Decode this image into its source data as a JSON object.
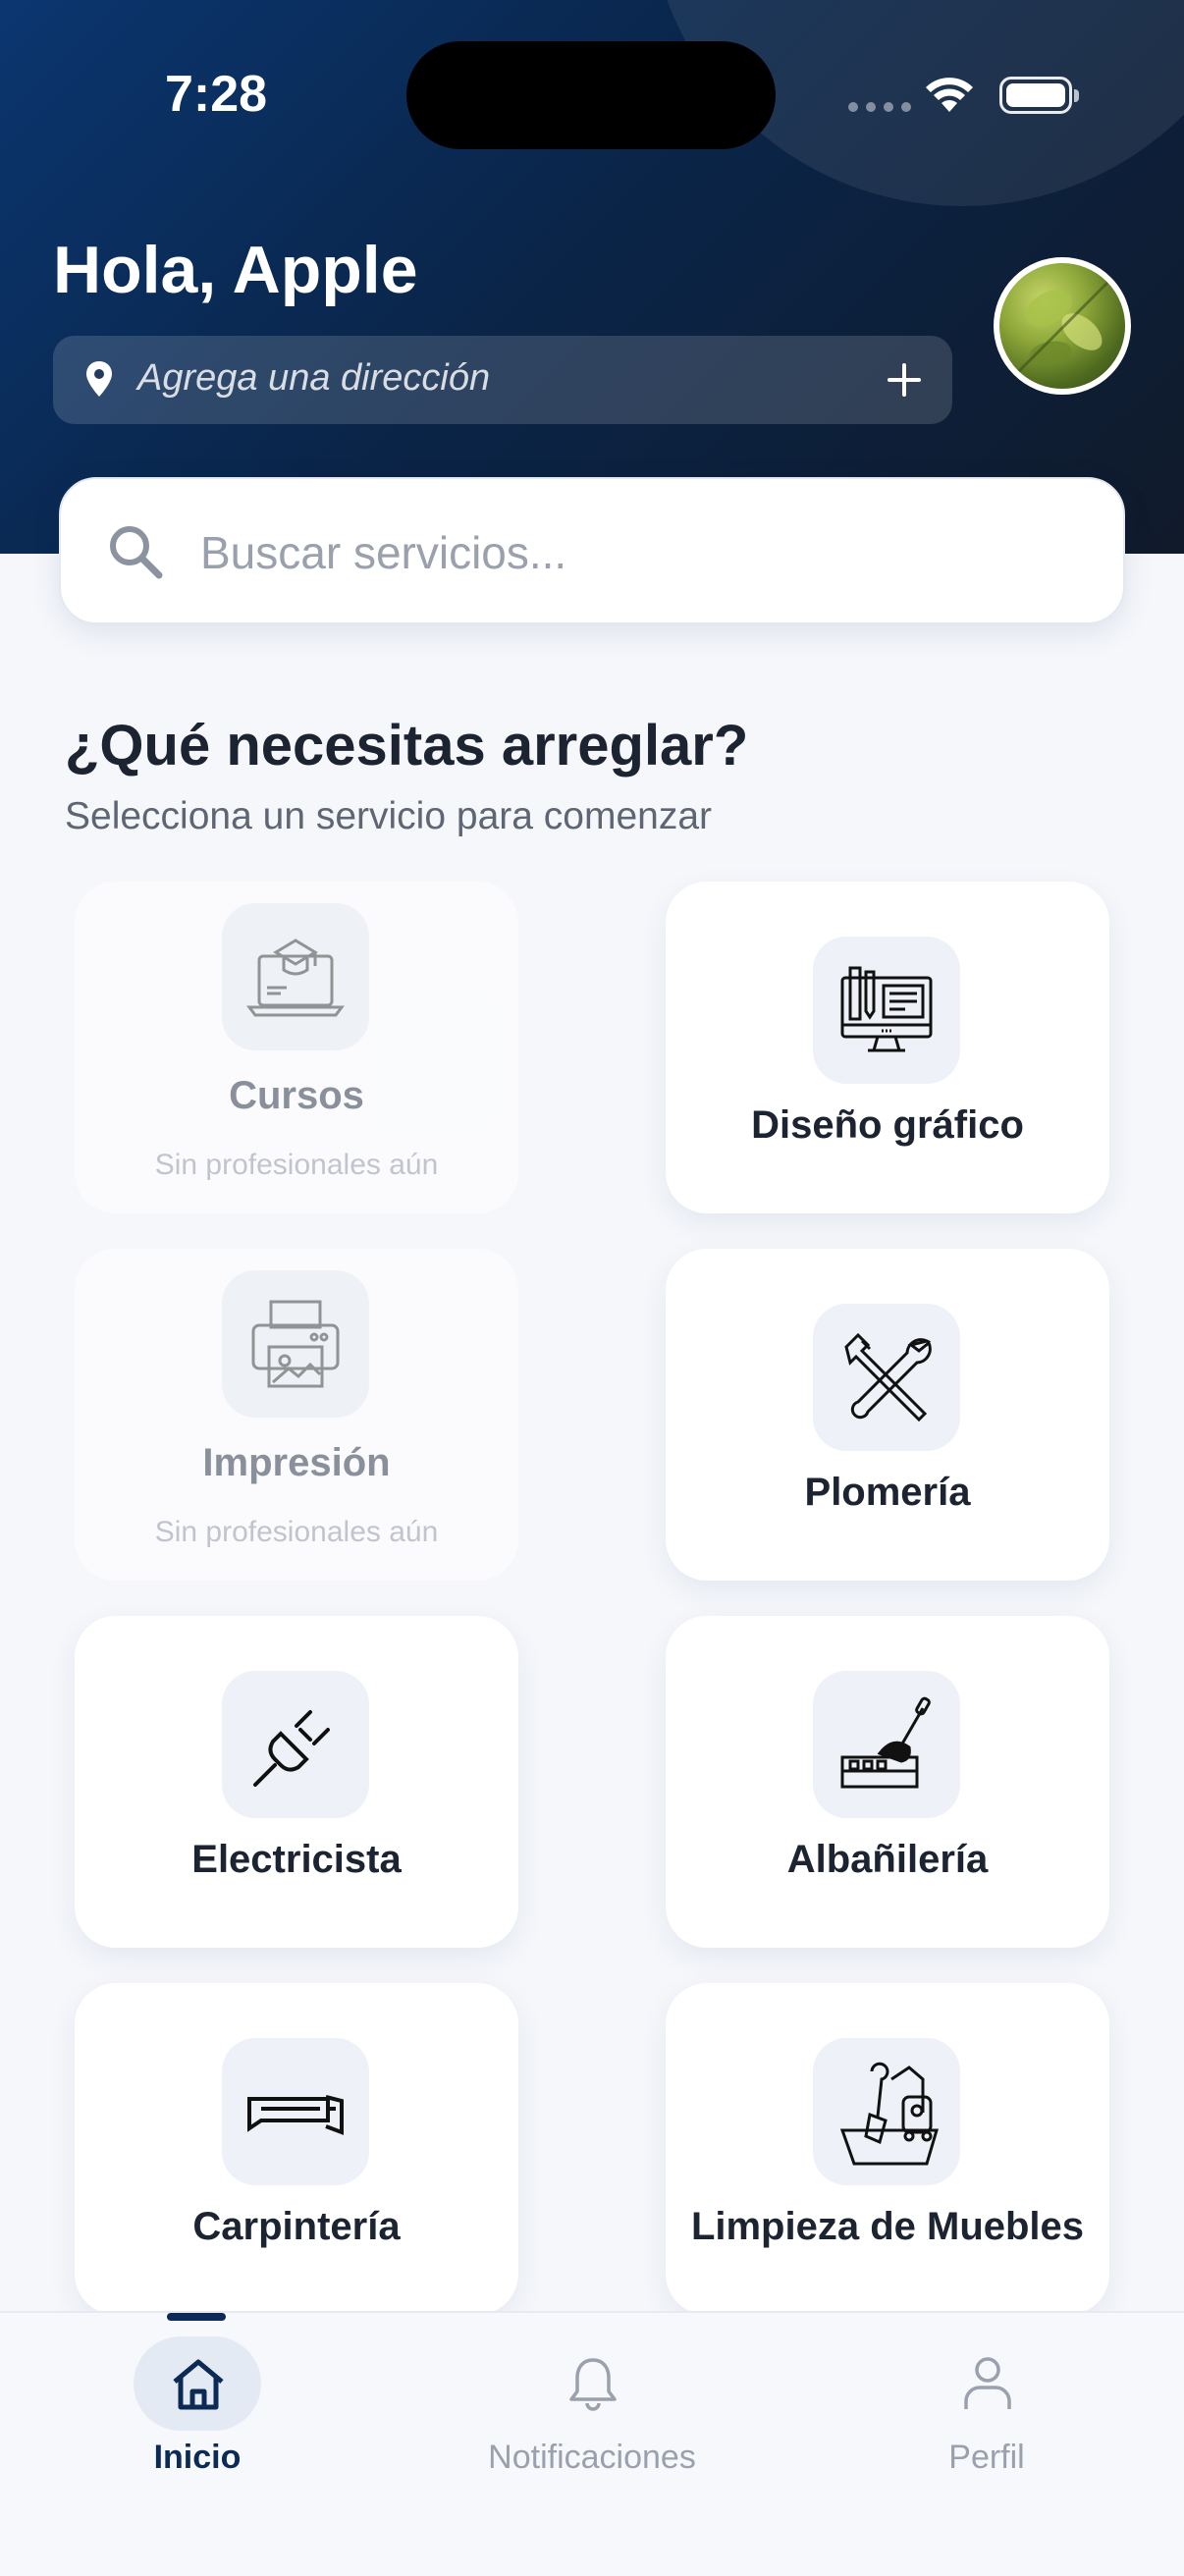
{
  "status_bar": {
    "time": "7:28"
  },
  "header": {
    "greeting": "Hola, Apple",
    "address_placeholder": "Agrega una dirección"
  },
  "search": {
    "placeholder": "Buscar servicios..."
  },
  "section": {
    "title": "¿Qué necesitas arreglar?",
    "subtitle": "Selecciona un servicio para comenzar"
  },
  "services": [
    {
      "label": "Cursos",
      "icon": "graduation-laptop-icon",
      "available": false,
      "note": "Sin profesionales aún"
    },
    {
      "label": "Diseño gráfico",
      "icon": "graphic-design-monitor-icon",
      "available": true
    },
    {
      "label": "Impresión",
      "icon": "printer-icon",
      "available": false,
      "note": "Sin profesionales aún"
    },
    {
      "label": "Plomería",
      "icon": "wrench-tools-icon",
      "available": true
    },
    {
      "label": "Electricista",
      "icon": "electric-plug-icon",
      "available": true
    },
    {
      "label": "Albañilería",
      "icon": "trowel-bricks-icon",
      "available": true
    },
    {
      "label": "Carpintería",
      "icon": "saw-icon",
      "available": true
    },
    {
      "label": "Limpieza de Muebles",
      "icon": "vacuum-cleaner-icon",
      "available": true
    }
  ],
  "tabbar": {
    "tabs": [
      {
        "label": "Inicio",
        "icon": "home-icon",
        "active": true
      },
      {
        "label": "Notificaciones",
        "icon": "bell-icon",
        "active": false
      },
      {
        "label": "Perfil",
        "icon": "user-icon",
        "active": false
      }
    ]
  },
  "colors": {
    "brand_navy": "#0b2a55",
    "background": "#f5f7fb"
  }
}
